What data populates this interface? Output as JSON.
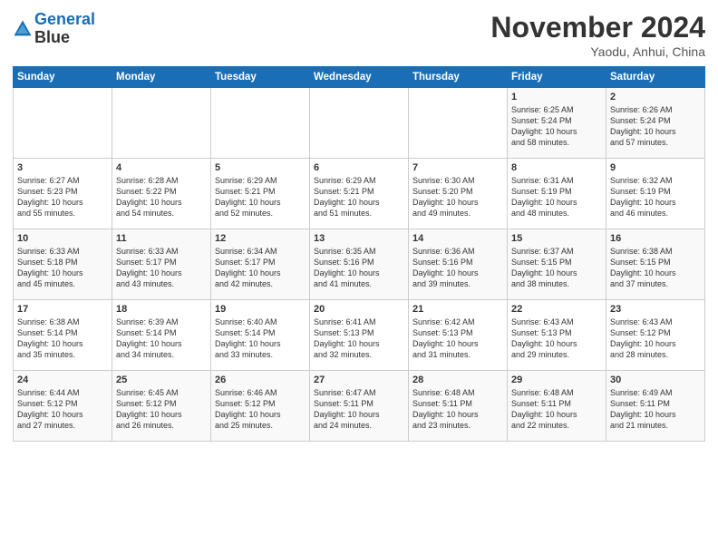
{
  "logo": {
    "line1": "General",
    "line2": "Blue"
  },
  "title": "November 2024",
  "location": "Yaodu, Anhui, China",
  "weekdays": [
    "Sunday",
    "Monday",
    "Tuesday",
    "Wednesday",
    "Thursday",
    "Friday",
    "Saturday"
  ],
  "weeks": [
    [
      {
        "day": "",
        "info": ""
      },
      {
        "day": "",
        "info": ""
      },
      {
        "day": "",
        "info": ""
      },
      {
        "day": "",
        "info": ""
      },
      {
        "day": "",
        "info": ""
      },
      {
        "day": "1",
        "info": "Sunrise: 6:25 AM\nSunset: 5:24 PM\nDaylight: 10 hours\nand 58 minutes."
      },
      {
        "day": "2",
        "info": "Sunrise: 6:26 AM\nSunset: 5:24 PM\nDaylight: 10 hours\nand 57 minutes."
      }
    ],
    [
      {
        "day": "3",
        "info": "Sunrise: 6:27 AM\nSunset: 5:23 PM\nDaylight: 10 hours\nand 55 minutes."
      },
      {
        "day": "4",
        "info": "Sunrise: 6:28 AM\nSunset: 5:22 PM\nDaylight: 10 hours\nand 54 minutes."
      },
      {
        "day": "5",
        "info": "Sunrise: 6:29 AM\nSunset: 5:21 PM\nDaylight: 10 hours\nand 52 minutes."
      },
      {
        "day": "6",
        "info": "Sunrise: 6:29 AM\nSunset: 5:21 PM\nDaylight: 10 hours\nand 51 minutes."
      },
      {
        "day": "7",
        "info": "Sunrise: 6:30 AM\nSunset: 5:20 PM\nDaylight: 10 hours\nand 49 minutes."
      },
      {
        "day": "8",
        "info": "Sunrise: 6:31 AM\nSunset: 5:19 PM\nDaylight: 10 hours\nand 48 minutes."
      },
      {
        "day": "9",
        "info": "Sunrise: 6:32 AM\nSunset: 5:19 PM\nDaylight: 10 hours\nand 46 minutes."
      }
    ],
    [
      {
        "day": "10",
        "info": "Sunrise: 6:33 AM\nSunset: 5:18 PM\nDaylight: 10 hours\nand 45 minutes."
      },
      {
        "day": "11",
        "info": "Sunrise: 6:33 AM\nSunset: 5:17 PM\nDaylight: 10 hours\nand 43 minutes."
      },
      {
        "day": "12",
        "info": "Sunrise: 6:34 AM\nSunset: 5:17 PM\nDaylight: 10 hours\nand 42 minutes."
      },
      {
        "day": "13",
        "info": "Sunrise: 6:35 AM\nSunset: 5:16 PM\nDaylight: 10 hours\nand 41 minutes."
      },
      {
        "day": "14",
        "info": "Sunrise: 6:36 AM\nSunset: 5:16 PM\nDaylight: 10 hours\nand 39 minutes."
      },
      {
        "day": "15",
        "info": "Sunrise: 6:37 AM\nSunset: 5:15 PM\nDaylight: 10 hours\nand 38 minutes."
      },
      {
        "day": "16",
        "info": "Sunrise: 6:38 AM\nSunset: 5:15 PM\nDaylight: 10 hours\nand 37 minutes."
      }
    ],
    [
      {
        "day": "17",
        "info": "Sunrise: 6:38 AM\nSunset: 5:14 PM\nDaylight: 10 hours\nand 35 minutes."
      },
      {
        "day": "18",
        "info": "Sunrise: 6:39 AM\nSunset: 5:14 PM\nDaylight: 10 hours\nand 34 minutes."
      },
      {
        "day": "19",
        "info": "Sunrise: 6:40 AM\nSunset: 5:14 PM\nDaylight: 10 hours\nand 33 minutes."
      },
      {
        "day": "20",
        "info": "Sunrise: 6:41 AM\nSunset: 5:13 PM\nDaylight: 10 hours\nand 32 minutes."
      },
      {
        "day": "21",
        "info": "Sunrise: 6:42 AM\nSunset: 5:13 PM\nDaylight: 10 hours\nand 31 minutes."
      },
      {
        "day": "22",
        "info": "Sunrise: 6:43 AM\nSunset: 5:13 PM\nDaylight: 10 hours\nand 29 minutes."
      },
      {
        "day": "23",
        "info": "Sunrise: 6:43 AM\nSunset: 5:12 PM\nDaylight: 10 hours\nand 28 minutes."
      }
    ],
    [
      {
        "day": "24",
        "info": "Sunrise: 6:44 AM\nSunset: 5:12 PM\nDaylight: 10 hours\nand 27 minutes."
      },
      {
        "day": "25",
        "info": "Sunrise: 6:45 AM\nSunset: 5:12 PM\nDaylight: 10 hours\nand 26 minutes."
      },
      {
        "day": "26",
        "info": "Sunrise: 6:46 AM\nSunset: 5:12 PM\nDaylight: 10 hours\nand 25 minutes."
      },
      {
        "day": "27",
        "info": "Sunrise: 6:47 AM\nSunset: 5:11 PM\nDaylight: 10 hours\nand 24 minutes."
      },
      {
        "day": "28",
        "info": "Sunrise: 6:48 AM\nSunset: 5:11 PM\nDaylight: 10 hours\nand 23 minutes."
      },
      {
        "day": "29",
        "info": "Sunrise: 6:48 AM\nSunset: 5:11 PM\nDaylight: 10 hours\nand 22 minutes."
      },
      {
        "day": "30",
        "info": "Sunrise: 6:49 AM\nSunset: 5:11 PM\nDaylight: 10 hours\nand 21 minutes."
      }
    ]
  ]
}
